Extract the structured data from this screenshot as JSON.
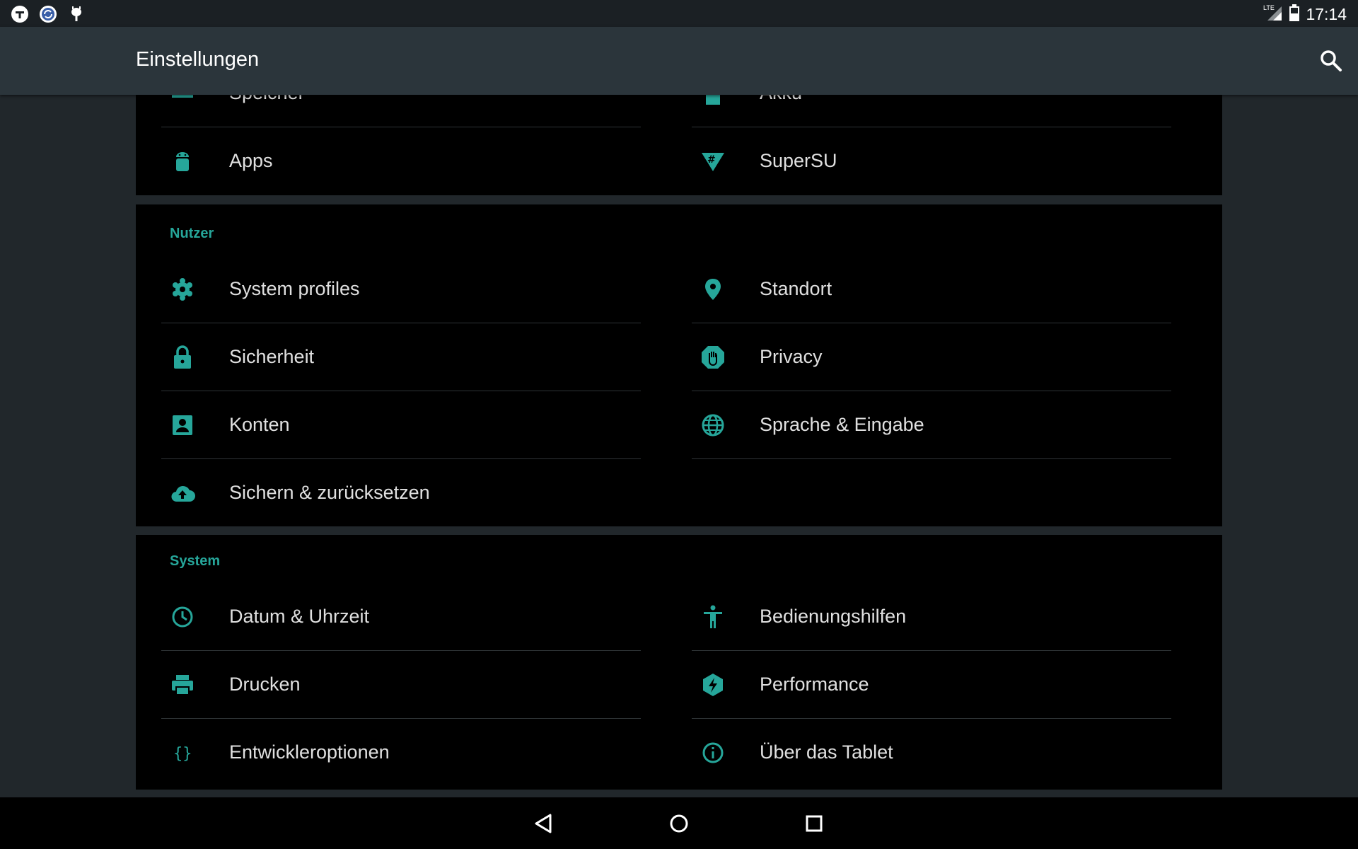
{
  "status_bar": {
    "time": "17:14",
    "network": "LTE",
    "notification_icons": [
      "wrench-app-icon",
      "sync-icon",
      "android-debug-icon"
    ],
    "system_icons": [
      "signal-icon",
      "battery-icon"
    ]
  },
  "app_bar": {
    "title": "Einstellungen",
    "search_icon": "search-icon"
  },
  "sections": {
    "device_partial": {
      "items": [
        {
          "label": "Speicher",
          "icon": "storage-icon"
        },
        {
          "label": "Akku",
          "icon": "battery-icon"
        },
        {
          "label": "Apps",
          "icon": "android-icon"
        },
        {
          "label": "SuperSU",
          "icon": "supersu-icon"
        }
      ]
    },
    "nutzer": {
      "header": "Nutzer",
      "items": [
        {
          "label": "System profiles",
          "icon": "profiles-icon"
        },
        {
          "label": "Standort",
          "icon": "location-icon"
        },
        {
          "label": "Sicherheit",
          "icon": "lock-icon"
        },
        {
          "label": "Privacy",
          "icon": "privacy-hand-icon"
        },
        {
          "label": "Konten",
          "icon": "account-icon"
        },
        {
          "label": "Sprache & Eingabe",
          "icon": "globe-icon"
        },
        {
          "label": "Sichern & zurücksetzen",
          "icon": "cloud-upload-icon"
        }
      ]
    },
    "system": {
      "header": "System",
      "items": [
        {
          "label": "Datum & Uhrzeit",
          "icon": "clock-icon"
        },
        {
          "label": "Bedienungshilfen",
          "icon": "accessibility-icon"
        },
        {
          "label": "Drucken",
          "icon": "printer-icon"
        },
        {
          "label": "Performance",
          "icon": "performance-icon"
        },
        {
          "label": "Entwickleroptionen",
          "icon": "braces-icon"
        },
        {
          "label": "Über das Tablet",
          "icon": "info-icon"
        }
      ]
    }
  },
  "nav_bar": {
    "buttons": [
      "back-icon",
      "home-icon",
      "recents-icon"
    ]
  },
  "colors": {
    "accent": "#26a69a",
    "app_bar": "#2b353b",
    "background": "#21272b",
    "card": "#000000"
  }
}
